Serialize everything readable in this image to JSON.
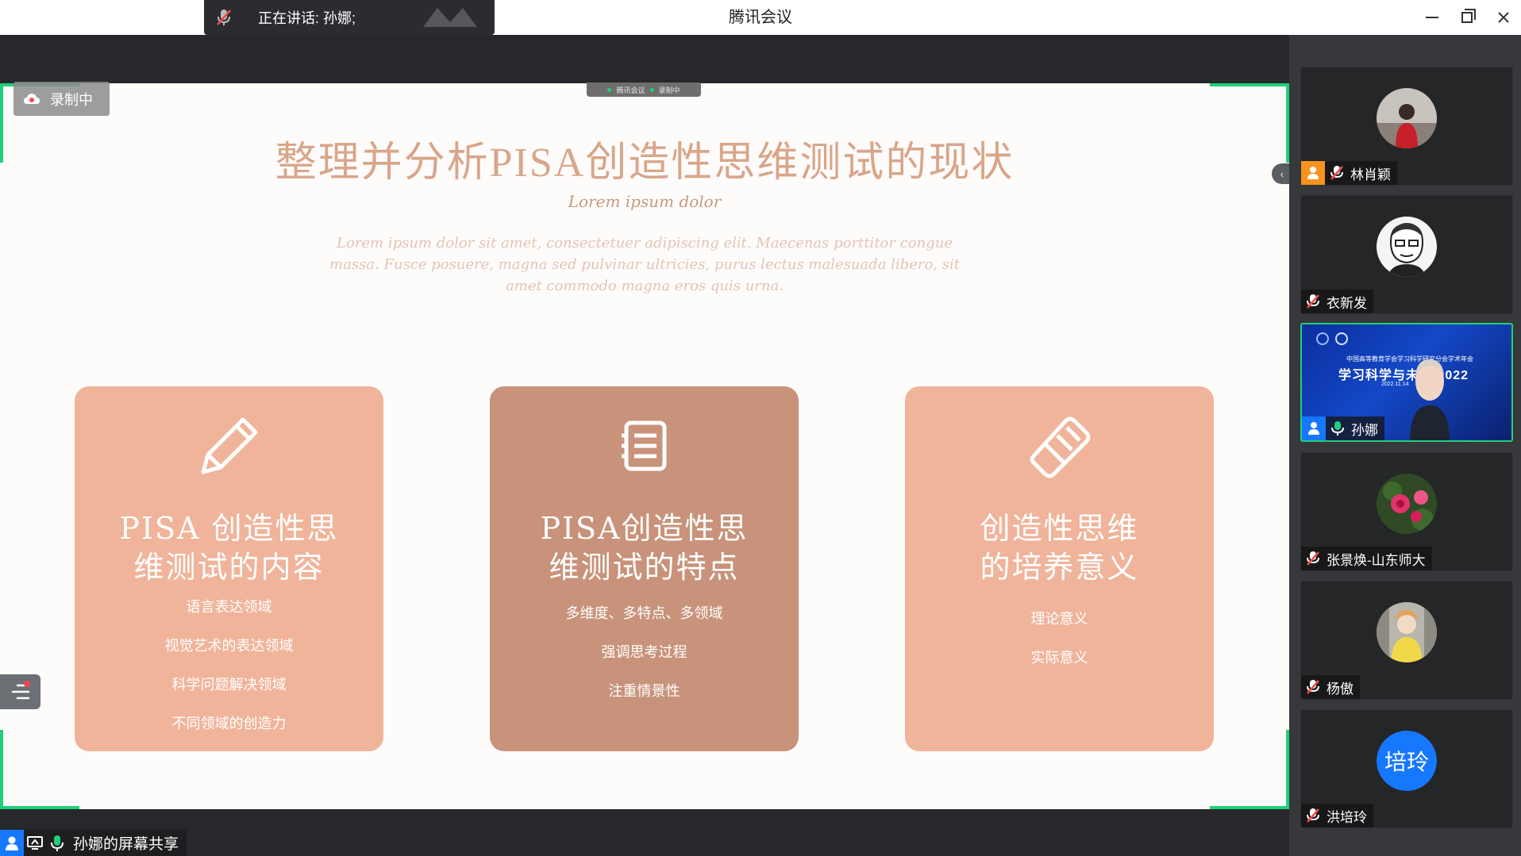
{
  "window": {
    "title": "腾讯会议"
  },
  "speaking": {
    "label": "正在讲话: 孙娜;"
  },
  "recording": {
    "label": "录制中"
  },
  "mini_bar": {
    "app": "腾讯会议",
    "rec": "录制中"
  },
  "slide": {
    "title": "整理并分析PISA创造性思维测试的现状",
    "subtitle": "Lorem ipsum dolor",
    "body": "Lorem ipsum dolor sit amet, consectetuer adipiscing elit. Maecenas porttitor congue massa. Fusce posuere, magna sed pulvinar ultricies, purus lectus malesuada libero, sit amet commodo magna eros quis urna.",
    "cards": [
      {
        "title_line1": "PISA 创造性思",
        "title_line2": "维测试的内容",
        "items": [
          "语言表达领域",
          "视觉艺术的表达领域",
          "科学问题解决领域",
          "不同领域的创造力"
        ]
      },
      {
        "title_line1": "PISA创造性思",
        "title_line2": "维测试的特点",
        "items": [
          "多维度、多特点、多领域",
          "强调思考过程",
          "注重情景性"
        ]
      },
      {
        "title_line1": "创造性思维",
        "title_line2": "的培养意义",
        "items": [
          "理论意义",
          "实际意义"
        ]
      }
    ]
  },
  "share": {
    "label": "孙娜的屏幕共享"
  },
  "participants": [
    {
      "name": "林肖颖",
      "host": true
    },
    {
      "name": "衣新发",
      "host": false
    },
    {
      "name": "孙娜",
      "host": true,
      "video": true,
      "video_text1": "中国高等教育学会学习科学研究分会学术年会",
      "video_text2": "学习科学与未来 2022",
      "video_text3": "2022.11.14"
    },
    {
      "name": "张景焕-山东师大",
      "host": false
    },
    {
      "name": "杨傲",
      "host": false
    },
    {
      "name": "洪培玲",
      "host": false,
      "initials": "培玲"
    }
  ],
  "colors": {
    "accent_green": "#1fd07a",
    "card_light": "#f0b49b",
    "card_dark": "#c8937a",
    "title_text": "#d8a68a"
  }
}
